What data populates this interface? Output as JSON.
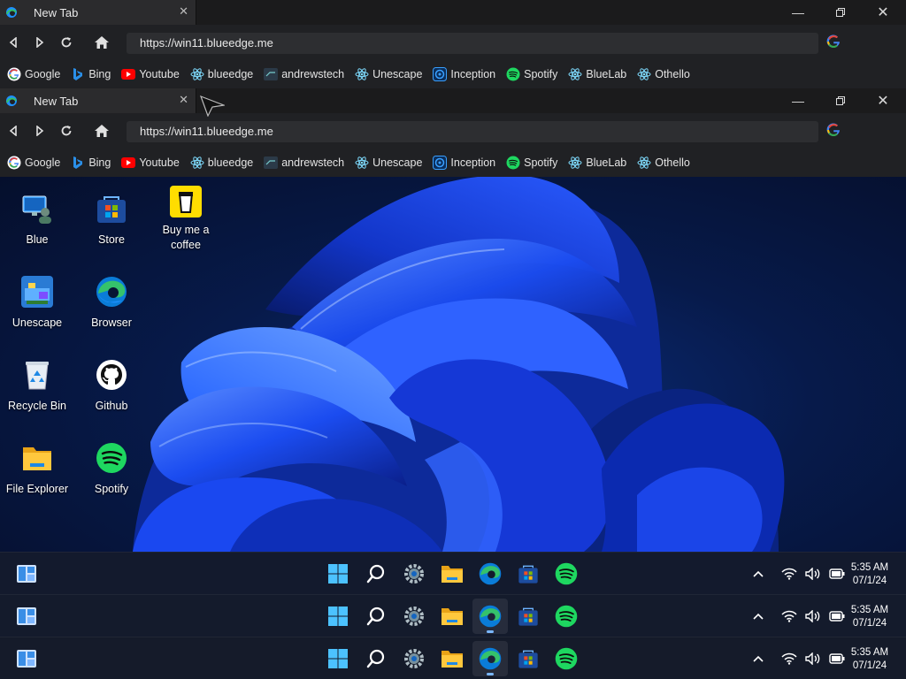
{
  "browser": {
    "tab_title": "New Tab",
    "address": "https://win11.blueedge.me",
    "bookmarks": [
      {
        "label": "Google",
        "icon": "google-icon"
      },
      {
        "label": "Bing",
        "icon": "bing-icon"
      },
      {
        "label": "Youtube",
        "icon": "youtube-icon"
      },
      {
        "label": "blueedge",
        "icon": "react-icon"
      },
      {
        "label": "andrewstech",
        "icon": "andrewstech-icon"
      },
      {
        "label": "Unescape",
        "icon": "react-icon"
      },
      {
        "label": "Inception",
        "icon": "inception-icon"
      },
      {
        "label": "Spotify",
        "icon": "spotify-icon"
      },
      {
        "label": "BlueLab",
        "icon": "react-icon"
      },
      {
        "label": "Othello",
        "icon": "react-icon"
      }
    ]
  },
  "desktop": {
    "icons": [
      {
        "label": "Blue",
        "icon": "user-pc-icon"
      },
      {
        "label": "Store",
        "icon": "store-icon"
      },
      {
        "label": "Buy me a coffee",
        "icon": "coffee-icon"
      },
      {
        "label": "Unescape",
        "icon": "unescape-icon"
      },
      {
        "label": "Browser",
        "icon": "edge-icon"
      },
      {
        "label": "Recycle Bin",
        "icon": "recycle-bin-icon"
      },
      {
        "label": "Github",
        "icon": "github-icon"
      },
      {
        "label": "File Explorer",
        "icon": "folder-icon"
      },
      {
        "label": "Spotify",
        "icon": "spotify-icon"
      }
    ]
  },
  "taskbar": {
    "time": "5:35 AM",
    "date": "07/1/24",
    "apps": [
      "start-icon",
      "search-icon",
      "settings-icon",
      "file-explorer-icon",
      "edge-icon",
      "store-icon",
      "spotify-icon"
    ]
  },
  "colors": {
    "accent": "#0078d4",
    "browser_bg": "#202124",
    "taskbar_bg": "#141b2c",
    "spotify": "#1ed760",
    "youtube": "#ff0000"
  }
}
